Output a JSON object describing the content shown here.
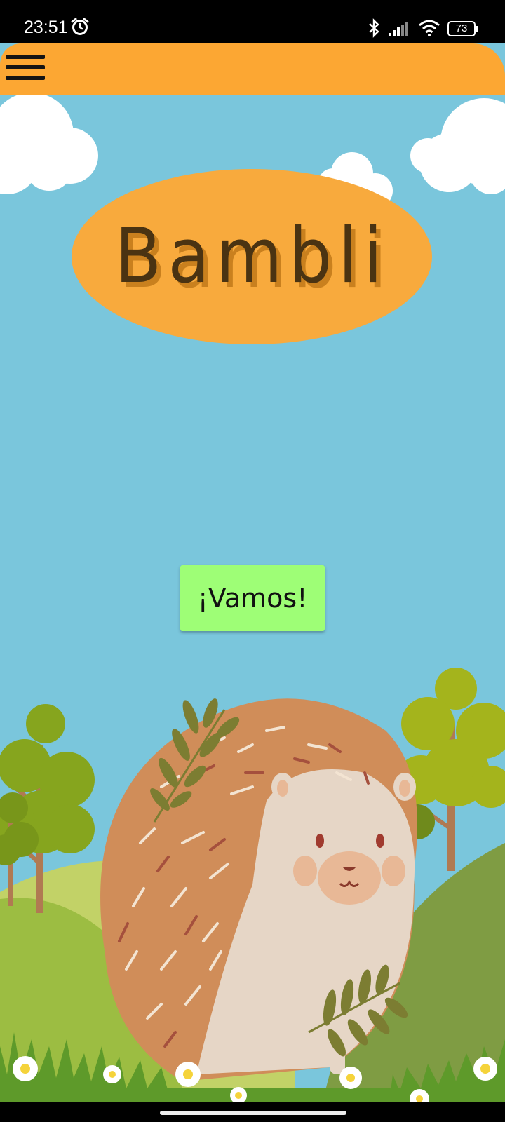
{
  "status_bar": {
    "time": "23:51",
    "battery": "73",
    "icons": [
      "alarm-icon",
      "bluetooth-icon",
      "cellular-signal-icon",
      "wifi-icon",
      "battery-icon"
    ]
  },
  "app_bar": {
    "color": "#fca733",
    "menu_icon": "hamburger-menu-icon"
  },
  "title": {
    "text": "Bambli",
    "oval_color": "#f8aa3d",
    "text_color": "#4a3312"
  },
  "cta": {
    "label": "¡Vamos!",
    "color": "#9efe76"
  },
  "background": {
    "sky_color": "#7ac6dc",
    "illustration": "hedgehog-in-meadow"
  }
}
